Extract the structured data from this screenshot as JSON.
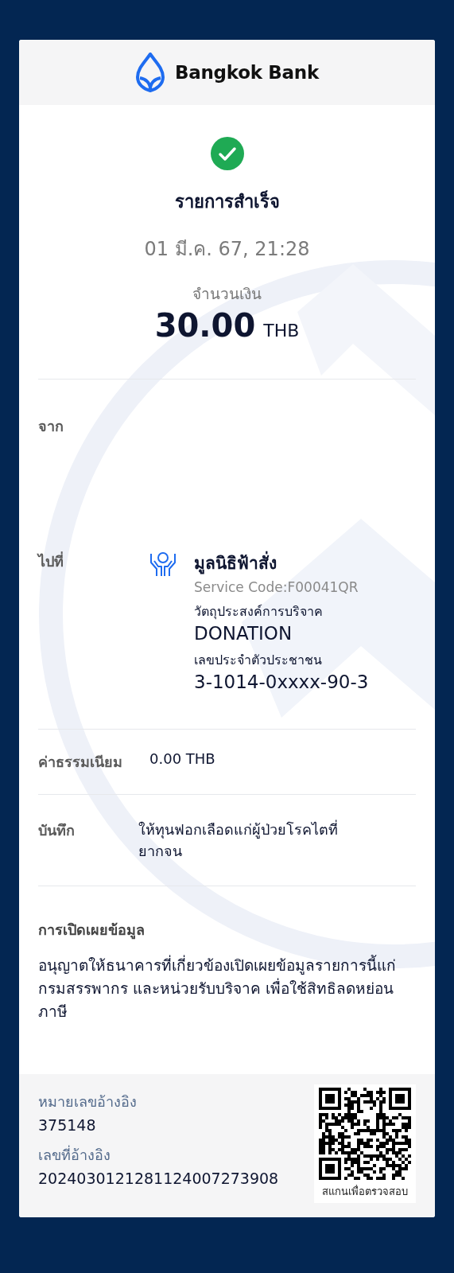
{
  "header": {
    "logo_text": "Bangkok Bank"
  },
  "status": {
    "kind": "success",
    "title": "รายการสำเร็จ"
  },
  "date": "01 มี.ค. 67, 21:28",
  "amount": {
    "label": "จำนวนเงิน",
    "value": "30.00",
    "currency": "THB"
  },
  "from": {
    "label": "จาก"
  },
  "to": {
    "label": "ไปที่",
    "name": "มูลนิธิฟ้าสั่ง",
    "service_code": "Service Code:F00041QR",
    "fields": [
      {
        "label": "วัตถุประสงค์การบริจาค",
        "value": "DONATION"
      },
      {
        "label": "เลขประจำตัวประชาชน",
        "value": "3-1014-0xxxx-90-3"
      }
    ]
  },
  "fee": {
    "label": "ค่าธรรมเนียม",
    "value": "0.00 THB"
  },
  "memo": {
    "label": "บันทึก",
    "value": "ให้ทุนฟอกเลือดแก่ผู้ป่วยโรคไตที่ยากจน"
  },
  "disclosure": {
    "title": "การเปิดเผยข้อมูล",
    "text": "อนุญาตให้ธนาคารที่เกี่ยวข้องเปิดเผยข้อมูลรายการนี้แก่กรมสรรพากร และหน่วยรับบริจาค เพื่อใช้สิทธิลดหย่อนภาษี"
  },
  "references": [
    {
      "label": "หมายเลขอ้างอิง",
      "value": "375148"
    },
    {
      "label": "เลขที่อ้างอิง",
      "value": "2024030121281124007273908"
    }
  ],
  "qr": {
    "caption": "สแกนเพื่อตรวจสอบ"
  }
}
